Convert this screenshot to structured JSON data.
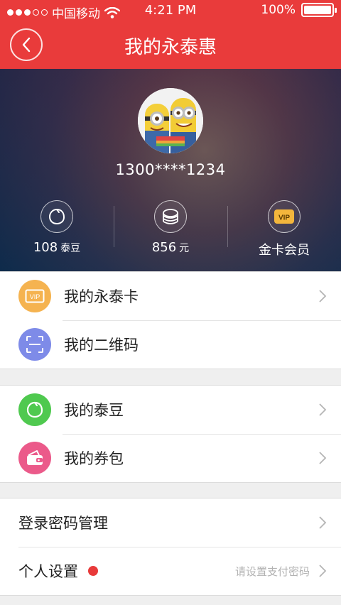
{
  "status_bar": {
    "carrier": "中国移动",
    "time": "4:21 PM",
    "battery": "100%"
  },
  "header": {
    "title": "我的永泰惠"
  },
  "profile": {
    "phone": "1300****1234",
    "stats": [
      {
        "value": "108",
        "unit": "泰豆",
        "icon": "bean-icon"
      },
      {
        "value": "856",
        "unit": "元",
        "icon": "coins-icon"
      },
      {
        "value": "金卡会员",
        "unit": "",
        "icon": "vip-badge-icon",
        "badge": "VIP"
      }
    ]
  },
  "menu": {
    "group1": [
      {
        "label": "我的永泰卡",
        "icon": "vip-card-icon",
        "icon_text": "VIP",
        "color": "#f5b350",
        "chevron": true
      },
      {
        "label": "我的二维码",
        "icon": "qr-code-icon",
        "color": "#7e8be8",
        "chevron": false
      }
    ],
    "group2": [
      {
        "label": "我的泰豆",
        "icon": "bean-icon",
        "color": "#4fc94f",
        "chevron": true
      },
      {
        "label": "我的券包",
        "icon": "wallet-icon",
        "color": "#eb5a8a",
        "chevron": true
      }
    ],
    "group3": [
      {
        "label": "登录密码管理",
        "chevron": true
      },
      {
        "label": "个人设置",
        "hint": "请设置支付密码",
        "chevron": true
      }
    ]
  },
  "colors": {
    "brand": "#e93b3b",
    "badge_dot": "#e83a3a"
  }
}
